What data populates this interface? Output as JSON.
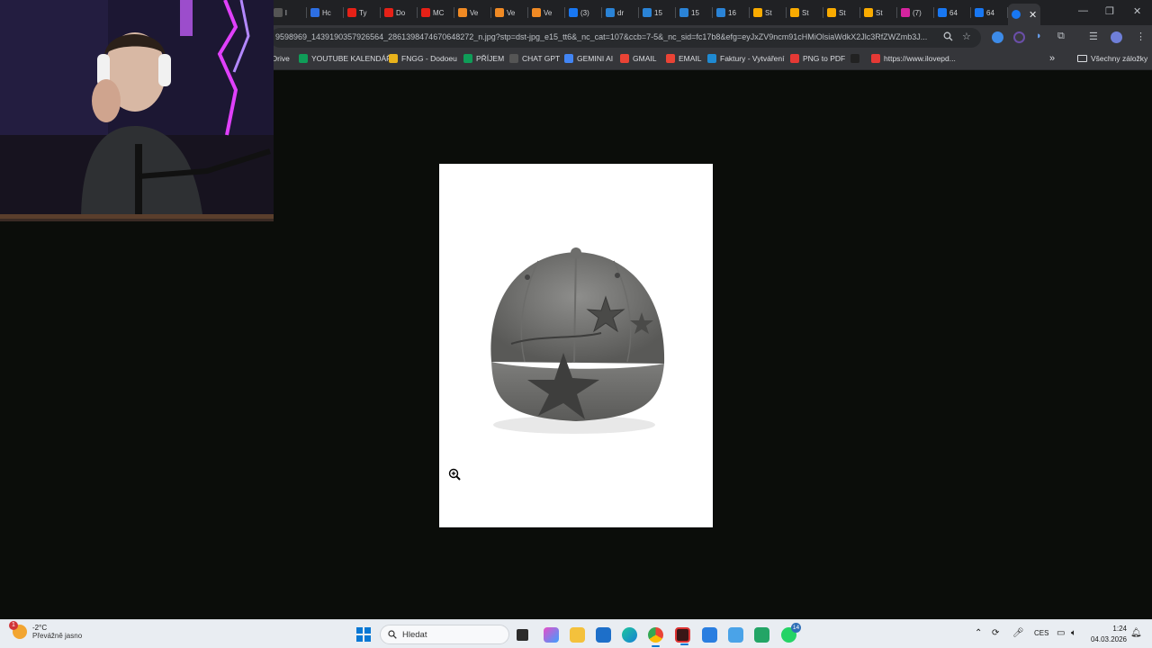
{
  "tabs": [
    {
      "label": "l",
      "color": "#555"
    },
    {
      "label": "Hc",
      "color": "#2d6fe4"
    },
    {
      "label": "Ty",
      "color": "#e62117"
    },
    {
      "label": "Do",
      "color": "#e62117"
    },
    {
      "label": "MC",
      "color": "#e62117"
    },
    {
      "label": "Ve",
      "color": "#f08a24"
    },
    {
      "label": "Ve",
      "color": "#f08a24"
    },
    {
      "label": "Ve",
      "color": "#f08a24"
    },
    {
      "label": "(3)",
      "color": "#1877f2"
    },
    {
      "label": "dr",
      "color": "#2a83d6"
    },
    {
      "label": "15",
      "color": "#2a83d6"
    },
    {
      "label": "15",
      "color": "#2a83d6"
    },
    {
      "label": "16",
      "color": "#2a83d6"
    },
    {
      "label": "St",
      "color": "#f9ab00"
    },
    {
      "label": "St",
      "color": "#f9ab00"
    },
    {
      "label": "St",
      "color": "#f9ab00"
    },
    {
      "label": "St",
      "color": "#f9ab00"
    },
    {
      "label": "(7)",
      "color": "#d6249f"
    },
    {
      "label": "64",
      "color": "#1877f2"
    },
    {
      "label": "64",
      "color": "#1877f2"
    }
  ],
  "active_tab": {
    "close": "✕",
    "color": "#1877f2"
  },
  "new_tab": "+",
  "window_controls": {
    "minimize": "—",
    "maximize": "❐",
    "close": "✕"
  },
  "address_bar": {
    "url": "9598969_1439190357926564_2861398474670648272_n.jpg?stp=dst-jpg_e15_tt6&_nc_cat=107&ccb=7-5&_nc_sid=fc17b8&efg=eyJxZV9ncm91cHMiOlsiaWdkX2Jlc3RfZWZmb3J..."
  },
  "bookmarks": [
    {
      "label": "Drive",
      "color": ""
    },
    {
      "label": "YOUTUBE KALENDÁŘ",
      "color": "#0f9d58"
    },
    {
      "label": "FNGG - Dodoeu",
      "color": "#e8b21b"
    },
    {
      "label": "PŘÍJEM",
      "color": "#0f9d58"
    },
    {
      "label": "CHAT GPT",
      "color": "#555555"
    },
    {
      "label": "GEMINI AI",
      "color": "#4285f4"
    },
    {
      "label": "GMAIL",
      "color": "#ea4335"
    },
    {
      "label": "EMAIL",
      "color": "#ea4335"
    },
    {
      "label": "Faktury - Vytváření",
      "color": "#1f8ad2"
    },
    {
      "label": "PNG to PDF",
      "color": "#e53935"
    },
    {
      "label": "",
      "color": "#222222"
    },
    {
      "label": "https://www.ilovepd...",
      "color": "#e53935"
    }
  ],
  "bookmarks_more": "»",
  "bookmarks_folder": "Všechny záložky",
  "taskbar": {
    "weather_temp": "-2°C",
    "weather_desc": "Převážně jasno",
    "weather_badge": "1",
    "search_placeholder": "Hledat",
    "whatsapp_badge": "14",
    "language": "CES",
    "time": "1:24",
    "date": "04.03.2026"
  }
}
